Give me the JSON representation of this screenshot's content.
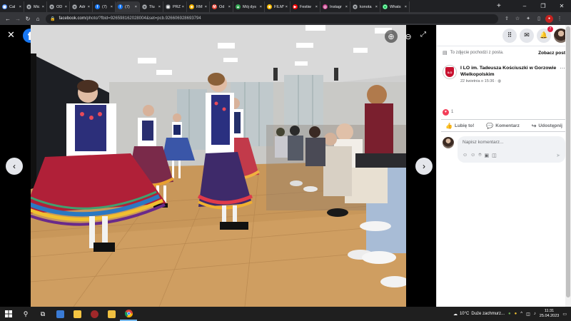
{
  "browser": {
    "tabs": [
      {
        "label": "Cal",
        "color": "#4285f4",
        "glyph": "▦"
      },
      {
        "label": "Mic",
        "color": "#5f6368",
        "glyph": "◯"
      },
      {
        "label": "OD",
        "color": "#5f6368",
        "glyph": "◯"
      },
      {
        "label": "Adr",
        "color": "#5f6368",
        "glyph": "◯"
      },
      {
        "label": "(7)",
        "color": "#1877f2",
        "glyph": "f"
      },
      {
        "label": "(7)",
        "color": "#1877f2",
        "glyph": "f"
      },
      {
        "label": "Tłu",
        "color": "#5f6368",
        "glyph": "◯"
      },
      {
        "label": "PRZ",
        "color": "#5f6368",
        "glyph": "▣"
      },
      {
        "label": "RM",
        "color": "#f4b400",
        "glyph": "■"
      },
      {
        "label": "Od",
        "color": "#ea4335",
        "glyph": "M"
      },
      {
        "label": "Mój dys",
        "color": "#34a853",
        "glyph": "▲"
      },
      {
        "label": "FILMY",
        "color": "#fbbc04",
        "glyph": "■"
      },
      {
        "label": "Festiw",
        "color": "#ff0000",
        "glyph": "▶"
      },
      {
        "label": "Instagr",
        "color": "#c13584",
        "glyph": "◎"
      },
      {
        "label": "konota",
        "color": "#5f6368",
        "glyph": "◯"
      },
      {
        "label": "Whats",
        "color": "#25d366",
        "glyph": "◯"
      }
    ],
    "active_tab_index": 5,
    "new_tab": "+",
    "url_host": "facebook.com",
    "url_path": "/photo/?fbid=926598162028004&set=pcb.926606928693794"
  },
  "viewer": {
    "close": "✕",
    "fb_logo": "f",
    "zoom_in": "⊕",
    "zoom_out": "⊖",
    "fullscreen": "⤢",
    "prev": "‹",
    "next": "›"
  },
  "panel": {
    "notif_count": "7",
    "source_text": "To zdjęcie pochodzi z posta.",
    "see_post": "Zobacz post",
    "author_name": "I LO im. Tadeusza Kościuszki w Gorzowie Wielkopolskim",
    "logo_text": "ILO",
    "date": "22 kwietnia o 15:36 ·",
    "reaction_count": "1",
    "actions": {
      "like": "Lubię to!",
      "comment": "Komentarz",
      "share": "Udostępnij"
    },
    "comment_placeholder": "Napisz komentarz..."
  },
  "taskbar": {
    "temperature": "10°C",
    "weather_text": "Duże zachmurz...",
    "time": "11:31",
    "date": "25.04.2023"
  }
}
